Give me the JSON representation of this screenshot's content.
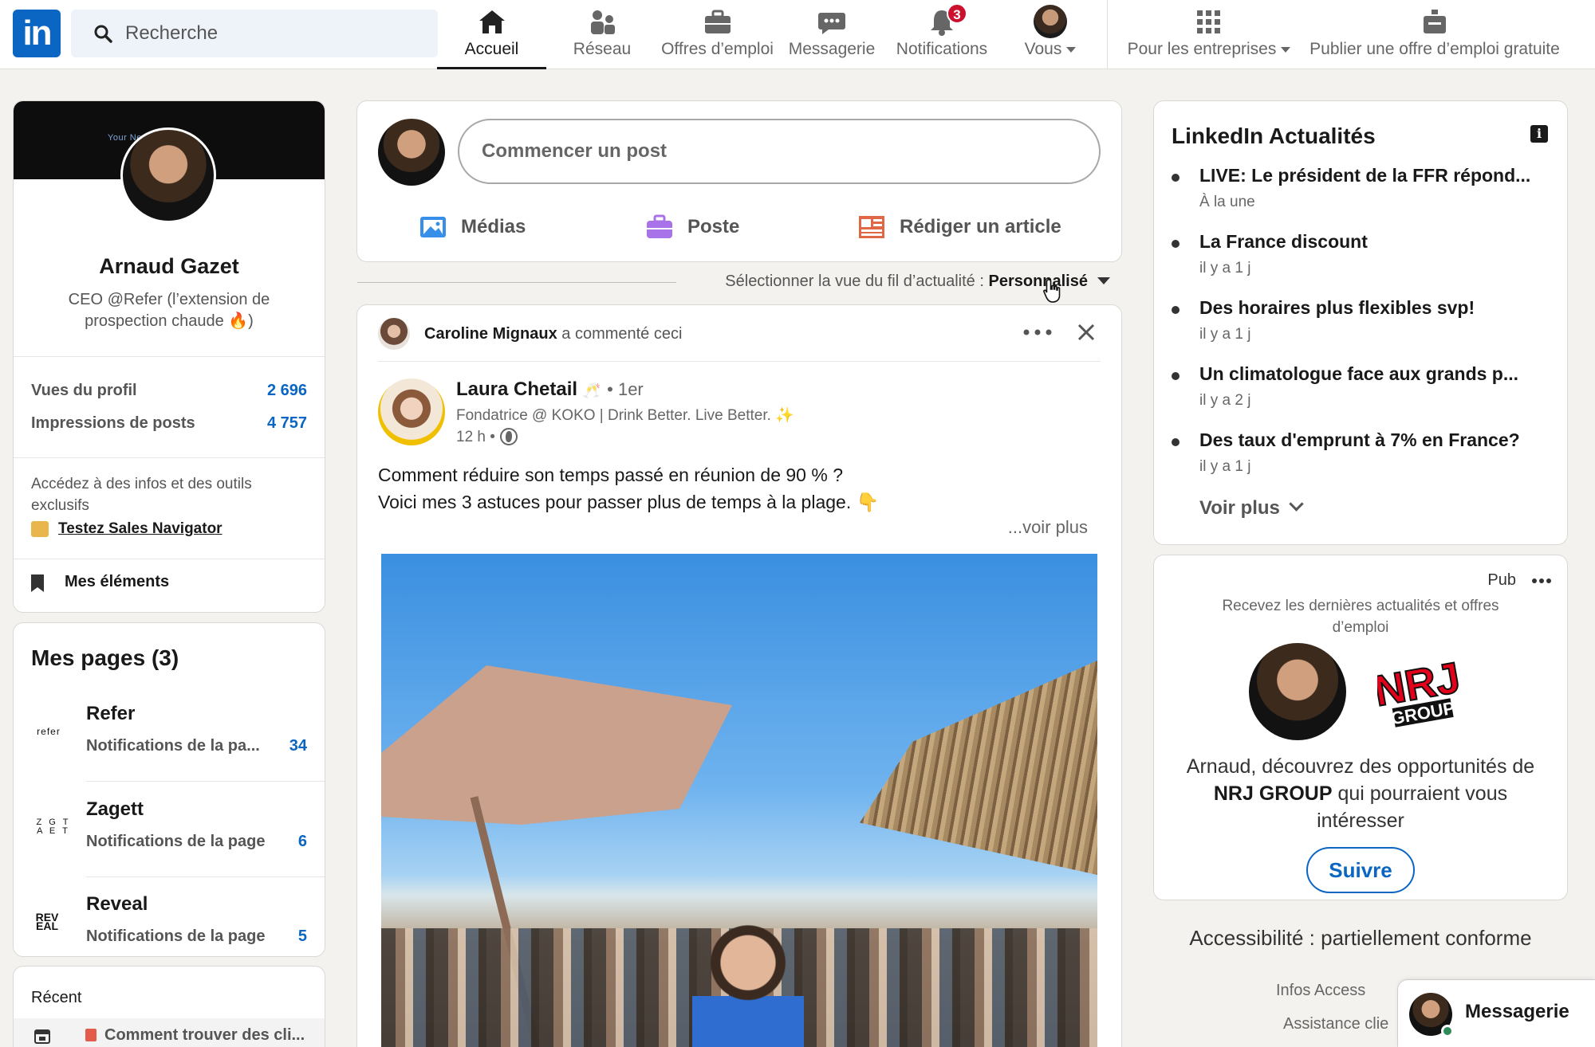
{
  "nav": {
    "logo": "in",
    "search_placeholder": "Recherche",
    "items": [
      {
        "label": "Accueil",
        "icon": "home-icon"
      },
      {
        "label": "Réseau",
        "icon": "network-icon"
      },
      {
        "label": "Offres d’emploi",
        "icon": "briefcase-icon"
      },
      {
        "label": "Messagerie",
        "icon": "message-icon"
      },
      {
        "label": "Notifications",
        "icon": "bell-icon",
        "badge": "3"
      },
      {
        "label": "Vous",
        "icon": "avatar"
      },
      {
        "label": "Pour les entreprises",
        "icon": "grid-icon"
      },
      {
        "label": "Publier une offre d’emploi gratuite",
        "icon": "job-post-icon"
      }
    ]
  },
  "profile": {
    "banner_text": "Your Ne        t Worth",
    "name": "Arnaud Gazet",
    "headline": "CEO @Refer (l’extension de prospection chaude 🔥)",
    "stats": [
      {
        "label": "Vues du profil",
        "value": "2 696"
      },
      {
        "label": "Impressions de posts",
        "value": "4 757"
      }
    ],
    "promo_text": "Accédez à des infos et des outils exclusifs",
    "promo_link": "Testez Sales Navigator",
    "saved_label": "Mes éléments"
  },
  "pages": {
    "title": "Mes pages (3)",
    "items": [
      {
        "logo": "refer",
        "name": "Refer",
        "sub": "Notifications de la pa...",
        "count": "34"
      },
      {
        "logo": "Z G T A E T",
        "name": "Zagett",
        "sub": "Notifications de la page",
        "count": "6"
      },
      {
        "logo": "REV EAL",
        "name": "Reveal",
        "sub": "Notifications de la page",
        "count": "5"
      }
    ]
  },
  "recent": {
    "title": "Récent",
    "item": "Comment trouver des cli..."
  },
  "composer": {
    "placeholder": "Commencer un post",
    "actions": [
      {
        "label": "Médias",
        "icon": "photo-icon",
        "color": "#378fe9"
      },
      {
        "label": "Poste",
        "icon": "briefcase-icon",
        "color": "#a872e8"
      },
      {
        "label": "Rédiger un article",
        "icon": "article-icon",
        "color": "#e06847"
      }
    ]
  },
  "feed": {
    "sort_prefix": "Sélectionner la vue du fil d’actualité : ",
    "sort_value": "Personnalisé"
  },
  "post": {
    "context_name": "Caroline Mignaux",
    "context_action": " a commenté ceci",
    "author_name": "Laura Chetail",
    "author_emoji": "🥂",
    "author_degree": "• 1er",
    "author_title": "Fondatrice @ KOKO | Drink Better. Live Better. ✨",
    "time": "12 h •",
    "text_line1": "Comment réduire son temps passé en réunion de 90 % ?",
    "text_line2": "Voici mes 3 astuces pour passer plus de temps à la plage. 👇",
    "see_more": "...voir plus"
  },
  "news": {
    "title": "LinkedIn Actualités",
    "info": "i",
    "items": [
      {
        "title": "LIVE: Le président de la FFR répond...",
        "sub": "À la une"
      },
      {
        "title": "La France discount",
        "sub": "il y a 1 j"
      },
      {
        "title": "Des horaires plus flexibles svp!",
        "sub": "il y a 1 j"
      },
      {
        "title": "Un climatologue face aux grands p...",
        "sub": "il y a 2 j"
      },
      {
        "title": "Des taux d'emprunt à 7% en France?",
        "sub": "il y a 1 j"
      }
    ],
    "more": "Voir plus"
  },
  "ad": {
    "label": "Pub",
    "text": "Recevez les dernières actualités et offres d’emploi",
    "body_prefix": "Arnaud, découvrez des opportunités de ",
    "company": "NRJ GROUP",
    "body_suffix": " qui pourraient vous intéresser",
    "logo_text": "NRJ",
    "logo_sub": "GROUP",
    "follow": "Suivre"
  },
  "footer": {
    "accessibility": "Accessibilité : partiellement conforme",
    "links1": "Infos      Access",
    "links2": "Assistance clie"
  },
  "messaging": {
    "label": "Messagerie"
  },
  "colors": {
    "brand": "#0a66c2",
    "badge": "#cb112d",
    "nrj_red": "#e2001a"
  }
}
